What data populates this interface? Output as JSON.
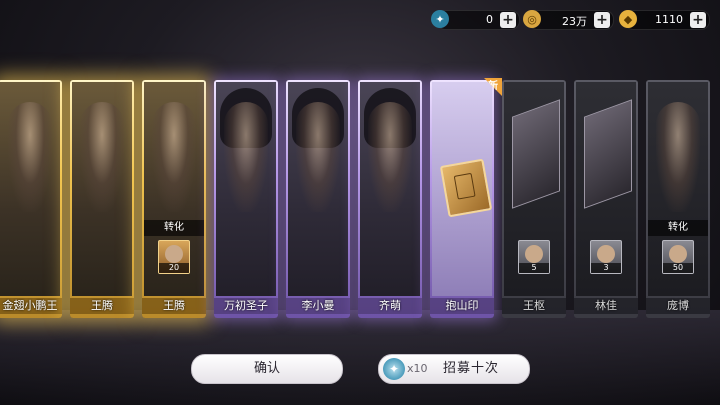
{
  "currencies": [
    {
      "icon": "gem-token-icon",
      "value": "0"
    },
    {
      "icon": "coin-icon",
      "value": "23万"
    },
    {
      "icon": "gold-ingot-icon",
      "value": "1110"
    }
  ],
  "cards": [
    {
      "name": "金翅小鹏王",
      "rarity": "gold"
    },
    {
      "name": "王腾",
      "rarity": "gold"
    },
    {
      "name": "王腾",
      "rarity": "gold",
      "convert": "转化",
      "count": "20"
    },
    {
      "name": "万初圣子",
      "rarity": "purple"
    },
    {
      "name": "李小曼",
      "rarity": "purple"
    },
    {
      "name": "齐萌",
      "rarity": "purple"
    },
    {
      "name": "抱山印",
      "rarity": "purple",
      "badge": "新"
    },
    {
      "name": "王枢",
      "rarity": "dim",
      "count": "5"
    },
    {
      "name": "林佳",
      "rarity": "dim",
      "count": "3"
    },
    {
      "name": "庞博",
      "rarity": "dim",
      "convert": "转化",
      "count": "50"
    }
  ],
  "buttons": {
    "confirm": "确认",
    "recruit_multiplier": "x10",
    "recruit": "招募十次"
  },
  "colors": {
    "gold": "#f0c450",
    "purple": "#b79ae8"
  }
}
